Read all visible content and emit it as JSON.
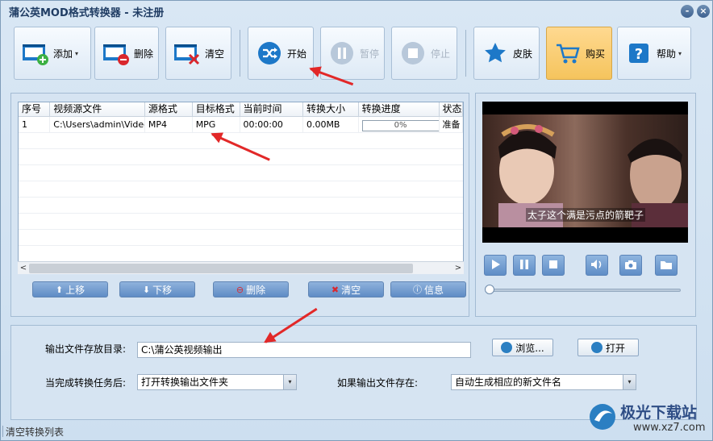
{
  "window": {
    "title": "蒲公英MOD格式转换器 - 未注册",
    "min_label": "-",
    "close_label": "×"
  },
  "toolbar": {
    "add": "添加",
    "delete": "删除",
    "clear": "清空",
    "start": "开始",
    "pause": "暂停",
    "stop": "停止",
    "skin": "皮肤",
    "buy": "购买",
    "help": "帮助",
    "dropdown": "▾"
  },
  "list": {
    "headers": [
      "序号",
      "视频源文件",
      "源格式",
      "目标格式",
      "当前时间",
      "转换大小",
      "转换进度",
      "状态"
    ],
    "rows": [
      [
        "1",
        "C:\\Users\\admin\\Video...",
        "MP4",
        "MPG",
        "00:00:00",
        "0.00MB",
        "0%",
        "准备"
      ]
    ],
    "scroll_left": "<",
    "scroll_right": ">",
    "buttons": {
      "up": "上移",
      "down": "下移",
      "delete": "删除",
      "clear": "清空",
      "info": "信息"
    }
  },
  "player": {
    "subtitle": "太子这个满是污点的箭靶子",
    "progress": 0
  },
  "output": {
    "dir_label": "输出文件存放目录:",
    "dir_value": "C:\\蒲公英视频输出",
    "browse": "浏览...",
    "open": "打开",
    "after_label": "当完成转换任务后:",
    "after_value": "打开转换输出文件夹",
    "exists_label": "如果输出文件存在:",
    "exists_value": "自动生成相应的新文件名"
  },
  "status": "清空转换列表",
  "watermark": {
    "name": "极光下载站",
    "url": "www.xz7.com"
  },
  "colors": {
    "accent": "#2b7fc2",
    "buy_bg": "#f5c45d",
    "arrow": "#e22828"
  }
}
